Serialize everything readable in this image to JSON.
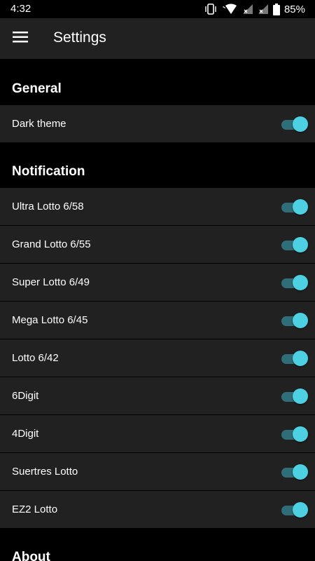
{
  "status_bar": {
    "time": "4:32",
    "battery_percent": "85%",
    "icons": [
      "vibrate-icon",
      "wifi-icon",
      "signal-x-icon",
      "signal-x-icon",
      "battery-icon"
    ]
  },
  "app_bar": {
    "title": "Settings",
    "menu_icon": "menu-icon"
  },
  "colors": {
    "accent": "#4dd0e1",
    "track": "#2f6e78",
    "surface": "#212121",
    "background": "#000000"
  },
  "sections": {
    "general": {
      "title": "General",
      "items": [
        {
          "label": "Dark theme",
          "enabled": true
        }
      ]
    },
    "notification": {
      "title": "Notification",
      "items": [
        {
          "label": "Ultra Lotto 6/58",
          "enabled": true
        },
        {
          "label": "Grand Lotto 6/55",
          "enabled": true
        },
        {
          "label": "Super Lotto 6/49",
          "enabled": true
        },
        {
          "label": "Mega Lotto 6/45",
          "enabled": true
        },
        {
          "label": "Lotto 6/42",
          "enabled": true
        },
        {
          "label": "6Digit",
          "enabled": true
        },
        {
          "label": "4Digit",
          "enabled": true
        },
        {
          "label": "Suertres Lotto",
          "enabled": true
        },
        {
          "label": "EZ2 Lotto",
          "enabled": true
        }
      ]
    },
    "about": {
      "title": "About"
    }
  }
}
